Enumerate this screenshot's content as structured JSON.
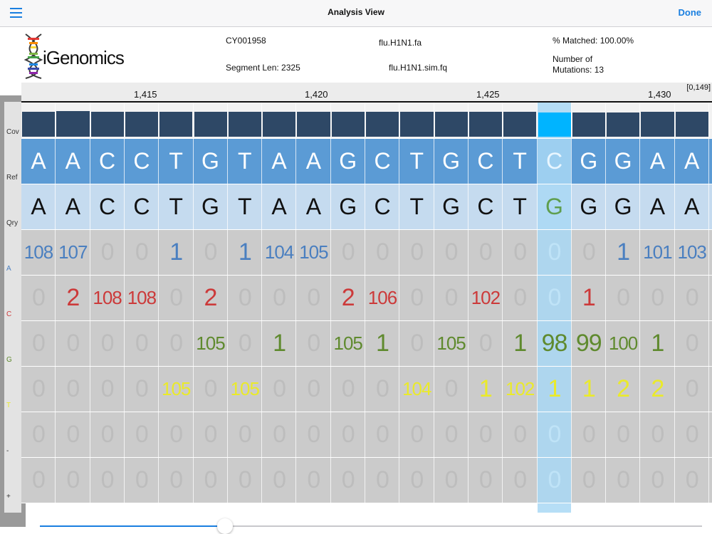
{
  "nav": {
    "title": "Analysis View",
    "done_label": "Done",
    "menu_icon": "hamburger-menu-icon"
  },
  "header": {
    "logo_text": "iGenomics",
    "accession": "CY001958",
    "segment_len": "Segment Len: 2325",
    "ref_file": "flu.H1N1.fa",
    "reads_file": "flu.H1N1.sim.fq",
    "percent_matched": "% Matched:  100.00%",
    "mutations_line1": "Number of",
    "mutations_line2": "Mutations: 13"
  },
  "ruler": {
    "ticks": [
      "1,415",
      "1,420",
      "1,425",
      "1,430"
    ],
    "range": "[0,149]"
  },
  "row_labels": [
    "Cov",
    "Ref",
    "Qry",
    "A",
    "C",
    "G",
    "T",
    "-",
    "+"
  ],
  "colors": {
    "cov_bar": "#2e4866",
    "cov_highlight": "#00b4ff",
    "ref_bg": "#5b9bd5",
    "qry_bg": "#c5dbef",
    "count_bg": "#cbcbcb",
    "highlight_col": "#a9d8f5",
    "A": "#4a7fc0",
    "C": "#cc3a3a",
    "G": "#5f8a2e",
    "T": "#eaea2a",
    "zero": "#bdbdbd",
    "mismatch_qry": "#5f9e4e"
  },
  "columns": [
    {
      "ref": "A",
      "qry": "A",
      "cov": 0.7,
      "A": "108",
      "C": "0",
      "G": "0",
      "T": "0",
      "del": "0",
      "ins": "0"
    },
    {
      "ref": "A",
      "qry": "A",
      "cov": 0.72,
      "A": "107",
      "C": "2",
      "G": "0",
      "T": "0",
      "del": "0",
      "ins": "0"
    },
    {
      "ref": "C",
      "qry": "C",
      "cov": 0.7,
      "A": "0",
      "C": "108",
      "G": "0",
      "T": "0",
      "del": "0",
      "ins": "0"
    },
    {
      "ref": "C",
      "qry": "C",
      "cov": 0.7,
      "A": "0",
      "C": "108",
      "G": "0",
      "T": "0",
      "del": "0",
      "ins": "0"
    },
    {
      "ref": "T",
      "qry": "T",
      "cov": 0.7,
      "A": "1",
      "C": "0",
      "G": "0",
      "T": "105",
      "del": "0",
      "ins": "0"
    },
    {
      "ref": "G",
      "qry": "G",
      "cov": 0.7,
      "A": "0",
      "C": "2",
      "G": "105",
      "T": "0",
      "del": "0",
      "ins": "0"
    },
    {
      "ref": "T",
      "qry": "T",
      "cov": 0.7,
      "A": "1",
      "C": "0",
      "G": "0",
      "T": "105",
      "del": "0",
      "ins": "0"
    },
    {
      "ref": "A",
      "qry": "A",
      "cov": 0.7,
      "A": "104",
      "C": "0",
      "G": "1",
      "T": "0",
      "del": "0",
      "ins": "0"
    },
    {
      "ref": "A",
      "qry": "A",
      "cov": 0.7,
      "A": "105",
      "C": "0",
      "G": "0",
      "T": "0",
      "del": "0",
      "ins": "0"
    },
    {
      "ref": "G",
      "qry": "G",
      "cov": 0.7,
      "A": "0",
      "C": "2",
      "G": "105",
      "T": "0",
      "del": "0",
      "ins": "0"
    },
    {
      "ref": "C",
      "qry": "C",
      "cov": 0.7,
      "A": "0",
      "C": "106",
      "G": "1",
      "T": "0",
      "del": "0",
      "ins": "0"
    },
    {
      "ref": "T",
      "qry": "T",
      "cov": 0.7,
      "A": "0",
      "C": "0",
      "G": "0",
      "T": "104",
      "del": "0",
      "ins": "0"
    },
    {
      "ref": "G",
      "qry": "G",
      "cov": 0.7,
      "A": "0",
      "C": "0",
      "G": "105",
      "T": "0",
      "del": "0",
      "ins": "0"
    },
    {
      "ref": "C",
      "qry": "C",
      "cov": 0.7,
      "A": "0",
      "C": "102",
      "G": "0",
      "T": "1",
      "del": "0",
      "ins": "0"
    },
    {
      "ref": "T",
      "qry": "T",
      "cov": 0.7,
      "A": "0",
      "C": "0",
      "G": "1",
      "T": "102",
      "del": "0",
      "ins": "0"
    },
    {
      "ref": "C",
      "qry": "G",
      "cov": 0.68,
      "A": "0",
      "C": "0",
      "G": "98",
      "T": "1",
      "del": "0",
      "ins": "0",
      "highlight": true
    },
    {
      "ref": "G",
      "qry": "G",
      "cov": 0.68,
      "A": "0",
      "C": "1",
      "G": "99",
      "T": "1",
      "del": "0",
      "ins": "0"
    },
    {
      "ref": "G",
      "qry": "G",
      "cov": 0.68,
      "A": "1",
      "C": "0",
      "G": "100",
      "T": "2",
      "del": "0",
      "ins": "0"
    },
    {
      "ref": "A",
      "qry": "A",
      "cov": 0.7,
      "A": "101",
      "C": "0",
      "G": "1",
      "T": "2",
      "del": "0",
      "ins": "0"
    },
    {
      "ref": "A",
      "qry": "A",
      "cov": 0.7,
      "A": "103",
      "C": "0",
      "G": "0",
      "T": "0",
      "del": "0",
      "ins": "0"
    }
  ],
  "slider": {
    "value": 0.28
  }
}
